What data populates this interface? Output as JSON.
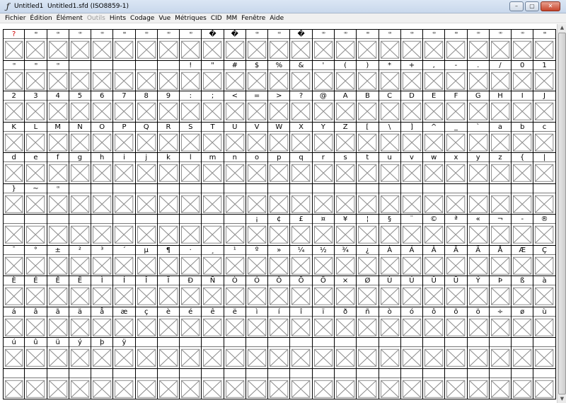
{
  "window": {
    "title": "Untitled1  Untitled1.sfd (ISO8859-1)",
    "app_icon": "fontforge-icon",
    "controls": [
      "–",
      "▢",
      "✕"
    ]
  },
  "menu": [
    {
      "label": "Fichier",
      "enabled": true
    },
    {
      "label": "Édition",
      "enabled": true
    },
    {
      "label": "Élément",
      "enabled": true
    },
    {
      "label": "Outils",
      "enabled": false
    },
    {
      "label": "Hints",
      "enabled": true
    },
    {
      "label": "Codage",
      "enabled": true
    },
    {
      "label": "Vue",
      "enabled": true
    },
    {
      "label": "Métriques",
      "enabled": true
    },
    {
      "label": "CID",
      "enabled": true
    },
    {
      "label": "MM",
      "enabled": true
    },
    {
      "label": "Fenêtre",
      "enabled": true
    },
    {
      "label": "Aide",
      "enabled": true
    }
  ],
  "font_view": {
    "columns": 25,
    "empty_glyph_icon": "cross-box-icon",
    "colors": {
      "special_label": "#d00000",
      "grid_line": "#000000"
    },
    "labels": [
      "?",
      "⁰⁰",
      "⁰⁰",
      "⁰⁰",
      "⁰⁰",
      "⁰⁰",
      "⁰⁰",
      "⁰⁰",
      "⁰⁰",
      "�",
      "�",
      "⁰⁰",
      "⁰⁰",
      "�",
      "⁰⁰",
      "⁰⁰",
      "⁰⁰",
      "⁰⁰",
      "⁰⁰",
      "⁰⁰",
      "⁰⁰",
      "⁰⁰",
      "⁰⁰",
      "⁰⁰",
      "⁰⁰",
      "⁰⁰",
      "⁰⁰",
      "⁰⁰",
      "",
      "",
      "",
      "",
      "",
      "!",
      "\"",
      "#",
      "$",
      "%",
      "&",
      "'",
      "(",
      ")",
      "*",
      "+",
      ",",
      "-",
      ".",
      "/",
      "0",
      "1",
      "2",
      "3",
      "4",
      "5",
      "6",
      "7",
      "8",
      "9",
      ":",
      ";",
      "<",
      "=",
      ">",
      "?",
      "@",
      "A",
      "B",
      "C",
      "D",
      "E",
      "F",
      "G",
      "H",
      "I",
      "J",
      "K",
      "L",
      "M",
      "N",
      "O",
      "P",
      "Q",
      "R",
      "S",
      "T",
      "U",
      "V",
      "W",
      "X",
      "Y",
      "Z",
      "[",
      "\\",
      "]",
      "^",
      "_",
      "`",
      "a",
      "b",
      "c",
      "d",
      "e",
      "f",
      "g",
      "h",
      "i",
      "j",
      "k",
      "l",
      "m",
      "n",
      "o",
      "p",
      "q",
      "r",
      "s",
      "t",
      "u",
      "v",
      "w",
      "x",
      "y",
      "z",
      "{",
      "|",
      "}",
      "~",
      "⁰⁰",
      "",
      "",
      "",
      "",
      "",
      "",
      "",
      "",
      "",
      "",
      "",
      "",
      "",
      "",
      "",
      "",
      "",
      "",
      "",
      "",
      "",
      "",
      "",
      "",
      "",
      "",
      "",
      "",
      "",
      "",
      "",
      "",
      "",
      "¡",
      "¢",
      "£",
      "¤",
      "¥",
      "¦",
      "§",
      "¨",
      "©",
      "ª",
      "«",
      "¬",
      "-",
      "®",
      "¯",
      "°",
      "±",
      "²",
      "³",
      "´",
      "µ",
      "¶",
      "·",
      "¸",
      "¹",
      "º",
      "»",
      "¼",
      "½",
      "¾",
      "¿",
      "À",
      "Á",
      "Â",
      "Ã",
      "Ä",
      "Å",
      "Æ",
      "Ç",
      "È",
      "É",
      "Ê",
      "Ë",
      "Ì",
      "Í",
      "Î",
      "Ï",
      "Ð",
      "Ñ",
      "Ò",
      "Ó",
      "Ô",
      "Õ",
      "Ö",
      "×",
      "Ø",
      "Ù",
      "Ú",
      "Û",
      "Ü",
      "Ý",
      "Þ",
      "ß",
      "à",
      "á",
      "â",
      "ã",
      "ä",
      "å",
      "æ",
      "ç",
      "è",
      "é",
      "ê",
      "ë",
      "ì",
      "í",
      "î",
      "ï",
      "ð",
      "ñ",
      "ò",
      "ó",
      "ô",
      "õ",
      "ö",
      "÷",
      "ø",
      "ù",
      "ú",
      "û",
      "ü",
      "ý",
      "þ",
      "ÿ",
      "",
      "",
      "",
      "",
      "",
      "",
      "",
      "",
      "",
      "",
      "",
      "",
      "",
      "",
      "",
      "",
      "",
      "",
      "",
      "",
      "",
      "",
      "",
      "",
      "",
      "",
      "",
      "",
      "",
      "",
      "",
      "",
      "",
      "",
      "",
      "",
      "",
      "",
      "",
      "",
      "",
      "",
      "",
      ""
    ]
  }
}
